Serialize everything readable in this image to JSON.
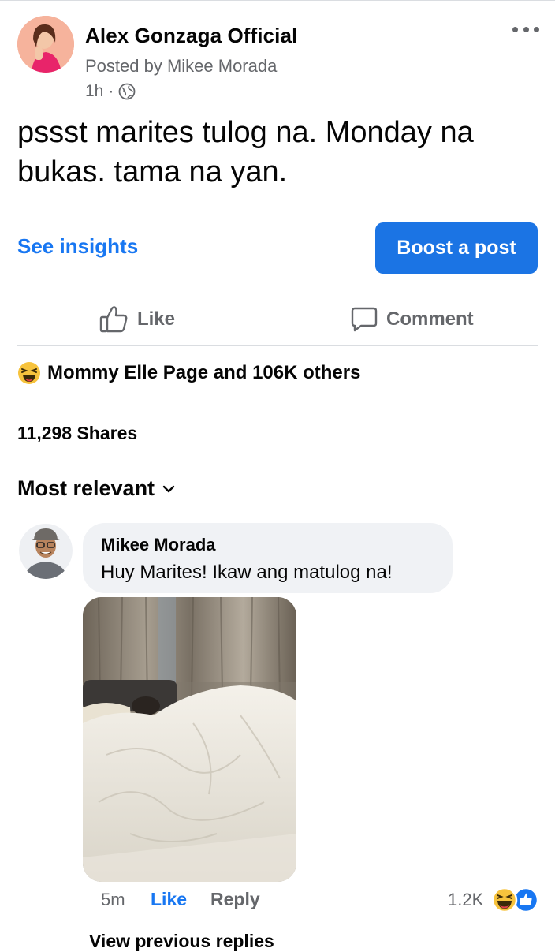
{
  "post": {
    "page_name": "Alex Gonzaga Official",
    "posted_by": "Posted by Mikee Morada",
    "time": "1h",
    "separator": "·",
    "privacy_icon": "globe-icon",
    "text": "pssst marites tulog na. Monday na bukas. tama na yan."
  },
  "actions": {
    "see_insights": "See insights",
    "boost": "Boost a post",
    "like": "Like",
    "comment": "Comment"
  },
  "engagement": {
    "reactions_text": "Mommy Elle Page and 106K others",
    "shares": "11,298 Shares"
  },
  "comments": {
    "sort_label": "Most relevant",
    "items": [
      {
        "author": "Mikee Morada",
        "text": "Huy Marites! Ikaw ang matulog na!",
        "time": "5m",
        "like_label": "Like",
        "reply_label": "Reply",
        "reaction_count": "1.2K"
      }
    ],
    "view_previous": "View previous replies"
  },
  "colors": {
    "accent": "#1877f2",
    "boost_bg": "#1b74e4",
    "muted": "#65676b",
    "bubble": "#f0f2f5",
    "divider": "#dadde1"
  }
}
